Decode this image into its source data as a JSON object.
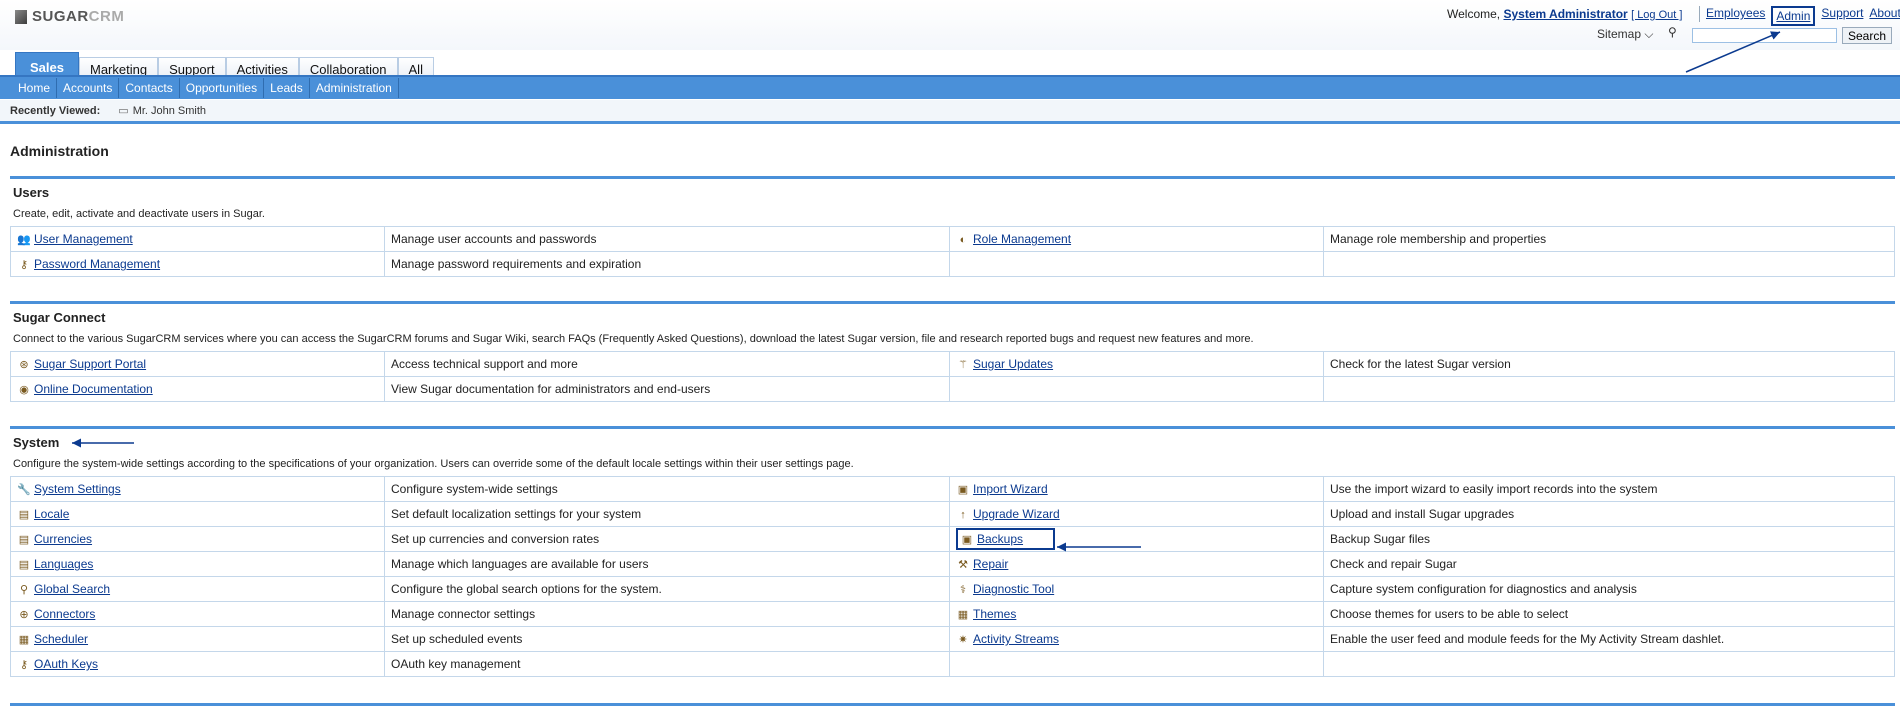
{
  "header": {
    "logo_main": "SUGAR",
    "logo_accent": "CRM",
    "welcome_prefix": "Welcome, ",
    "user_name": "System Administrator",
    "logout": "[ Log Out ]",
    "links": {
      "employees": "Employees",
      "admin": "Admin",
      "support": "Support",
      "about": "About"
    },
    "sitemap": "Sitemap",
    "search_value": "",
    "search_button": "Search"
  },
  "tabs": [
    {
      "label": "Sales",
      "active": true
    },
    {
      "label": "Marketing"
    },
    {
      "label": "Support"
    },
    {
      "label": "Activities"
    },
    {
      "label": "Collaboration"
    },
    {
      "label": "All"
    }
  ],
  "subnav": [
    "Home",
    "Accounts",
    "Contacts",
    "Opportunities",
    "Leads",
    "Administration"
  ],
  "recent": {
    "label": "Recently Viewed:",
    "item": "Mr. John Smith"
  },
  "page_title": "Administration",
  "sections": {
    "users": {
      "title": "Users",
      "desc": "Create, edit, activate and deactivate users in Sugar.",
      "rows": [
        {
          "l1": "User Management",
          "d1": "Manage user accounts and passwords",
          "l2": "Role Management",
          "d2": "Manage role membership and properties"
        },
        {
          "l1": "Password Management",
          "d1": "Manage password requirements and expiration",
          "l2": "",
          "d2": ""
        }
      ]
    },
    "connect": {
      "title": "Sugar Connect",
      "desc": "Connect to the various SugarCRM services where you can access the SugarCRM forums and Sugar Wiki, search FAQs (Frequently Asked Questions), download the latest Sugar version, file and research reported bugs and request new features and more.",
      "rows": [
        {
          "l1": "Sugar Support Portal",
          "d1": "Access technical support and more",
          "l2": "Sugar Updates",
          "d2": "Check for the latest Sugar version"
        },
        {
          "l1": "Online Documentation",
          "d1": "View Sugar documentation for administrators and end-users",
          "l2": "",
          "d2": ""
        }
      ]
    },
    "system": {
      "title": "System",
      "desc": "Configure the system-wide settings according to the specifications of your organization. Users can override some of the default locale settings within their user settings page.",
      "rows": [
        {
          "l1": "System Settings",
          "d1": "Configure system-wide settings",
          "l2": "Import Wizard",
          "d2": "Use the import wizard to easily import records into the system"
        },
        {
          "l1": "Locale",
          "d1": "Set default localization settings for your system",
          "l2": "Upgrade Wizard",
          "d2": "Upload and install Sugar upgrades"
        },
        {
          "l1": "Currencies",
          "d1": "Set up currencies and conversion rates",
          "l2": "Backups",
          "d2": "Backup Sugar files"
        },
        {
          "l1": "Languages",
          "d1": "Manage which languages are available for users",
          "l2": "Repair",
          "d2": "Check and repair Sugar"
        },
        {
          "l1": "Global Search",
          "d1": "Configure the global search options for the system.",
          "l2": "Diagnostic Tool",
          "d2": "Capture system configuration for diagnostics and analysis"
        },
        {
          "l1": "Connectors",
          "d1": "Manage connector settings",
          "l2": "Themes",
          "d2": "Choose themes for users to be able to select"
        },
        {
          "l1": "Scheduler",
          "d1": "Set up scheduled events",
          "l2": "Activity Streams",
          "d2": "Enable the user feed and module feeds for the My Activity Stream dashlet."
        },
        {
          "l1": "OAuth Keys",
          "d1": "OAuth key management",
          "l2": "",
          "d2": ""
        }
      ]
    }
  },
  "colors": {
    "accent": "#4a90d9",
    "link": "#0b3a8f",
    "annotation": "#0b3a8f"
  }
}
